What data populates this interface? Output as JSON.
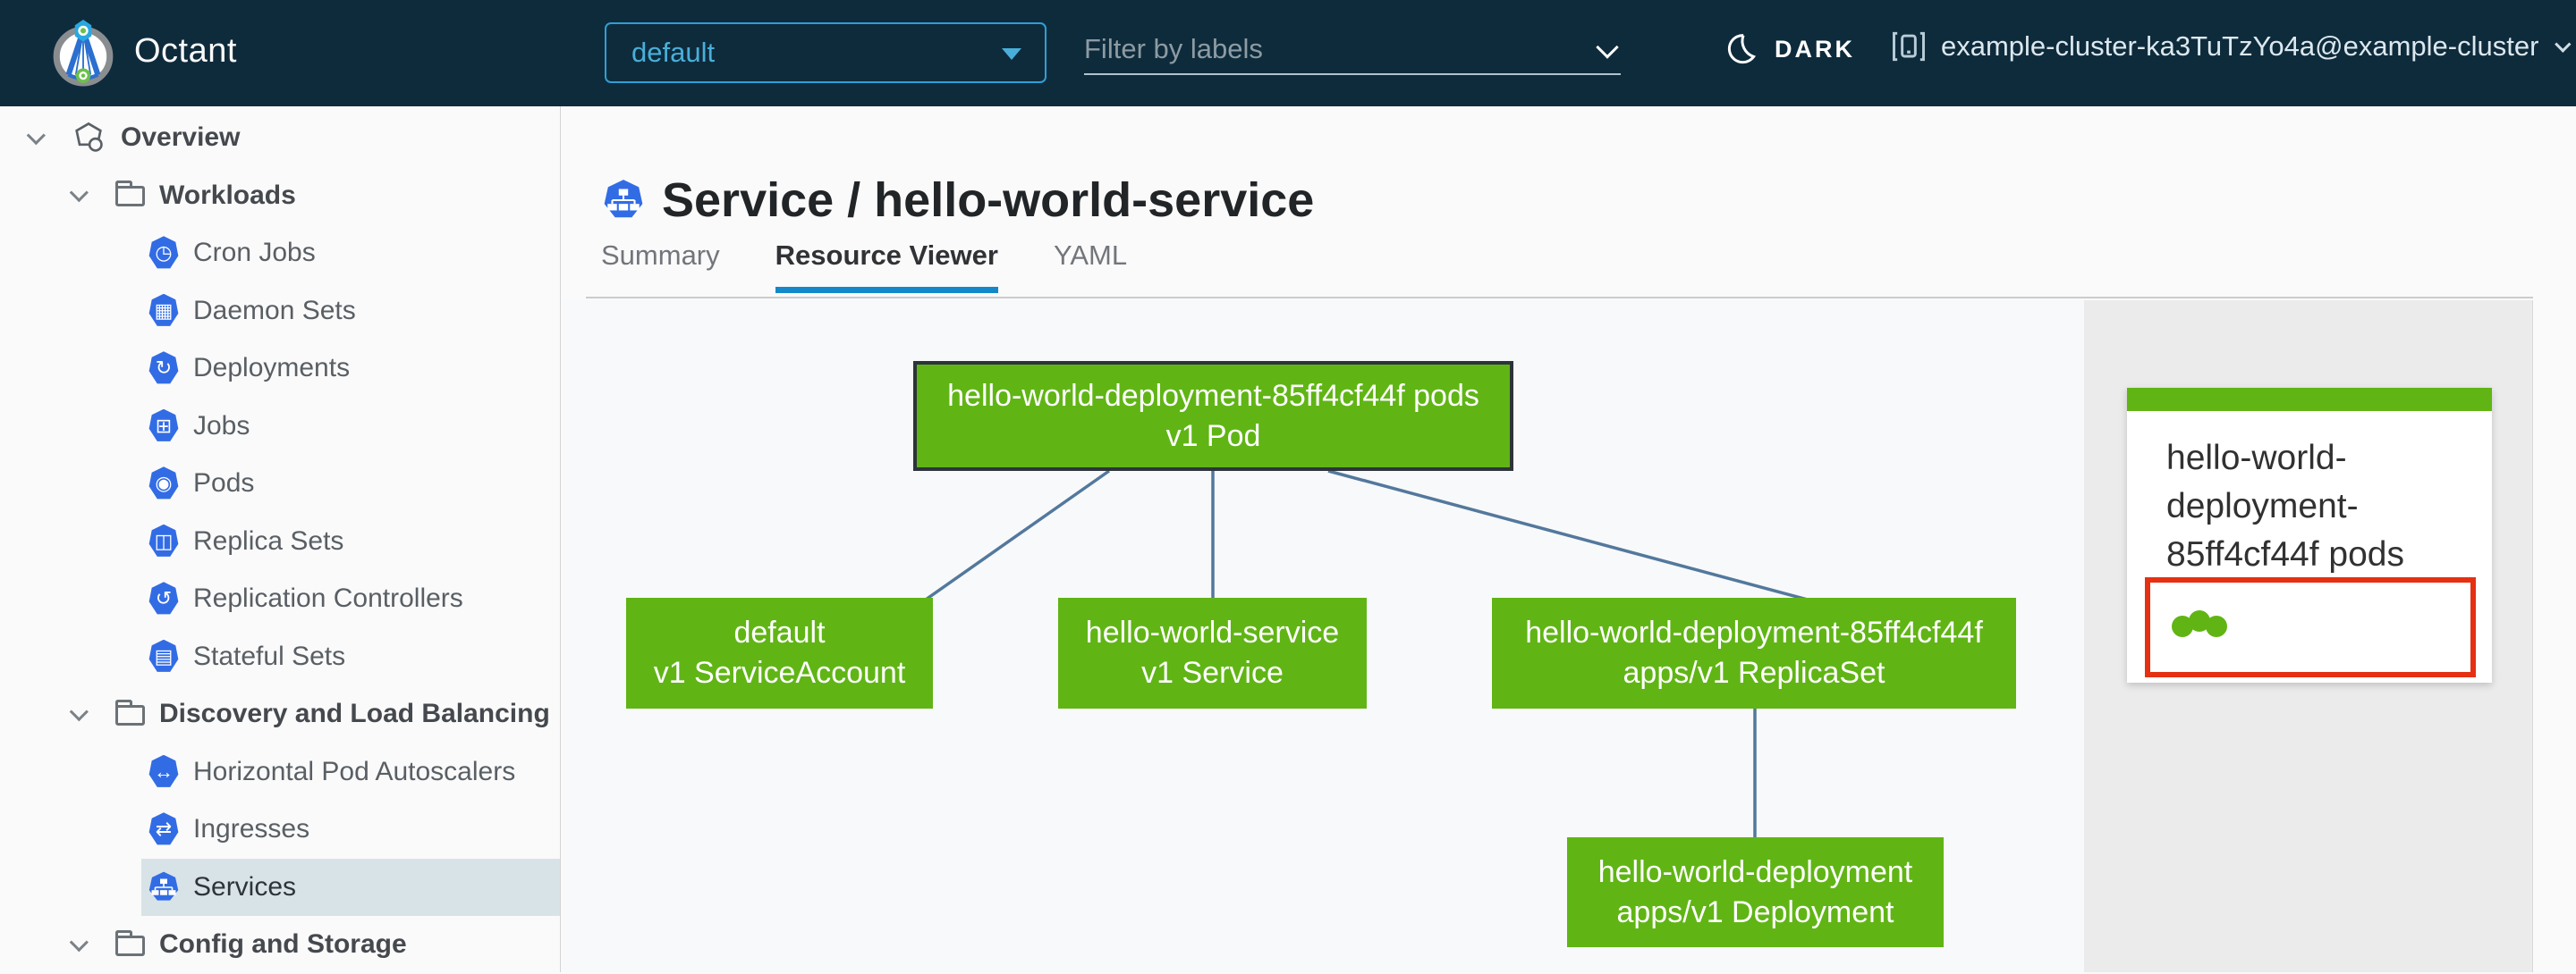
{
  "header": {
    "app_title": "Octant",
    "namespace_selector": {
      "value": "default"
    },
    "label_filter": {
      "placeholder": "Filter by labels"
    },
    "theme_toggle": {
      "label": "DARK"
    },
    "cluster": {
      "name": "example-cluster-ka3TuTzYo4a@example-cluster"
    }
  },
  "sidebar": {
    "items": [
      {
        "label": "Overview",
        "icon": "applications-icon",
        "glyph": ""
      },
      {
        "label": "Workloads",
        "icon": "folder-icon",
        "glyph": ""
      },
      {
        "label": "Cron Jobs",
        "icon": "k8s-cronjob-badge",
        "glyph": "◷"
      },
      {
        "label": "Daemon Sets",
        "icon": "k8s-daemonset-badge",
        "glyph": "▦"
      },
      {
        "label": "Deployments",
        "icon": "k8s-deployment-badge",
        "glyph": "↻"
      },
      {
        "label": "Jobs",
        "icon": "k8s-job-badge",
        "glyph": "⊞"
      },
      {
        "label": "Pods",
        "icon": "k8s-pod-badge",
        "glyph": "◉"
      },
      {
        "label": "Replica Sets",
        "icon": "k8s-replicaset-badge",
        "glyph": "◫"
      },
      {
        "label": "Replication Controllers",
        "icon": "k8s-replicationcontroller-badge",
        "glyph": "↺"
      },
      {
        "label": "Stateful Sets",
        "icon": "k8s-statefulset-badge",
        "glyph": "▤"
      },
      {
        "label": "Discovery and Load Balancing",
        "icon": "folder-icon",
        "glyph": ""
      },
      {
        "label": "Horizontal Pod Autoscalers",
        "icon": "k8s-hpa-badge",
        "glyph": "↔"
      },
      {
        "label": "Ingresses",
        "icon": "k8s-ingress-badge",
        "glyph": "⇄"
      },
      {
        "label": "Services",
        "icon": "k8s-service-badge",
        "glyph": ""
      },
      {
        "label": "Config and Storage",
        "icon": "folder-icon",
        "glyph": ""
      }
    ],
    "selected_item": "Services"
  },
  "main": {
    "page_title": "Service / hello-world-service",
    "title_icon": "k8s-service-badge",
    "tabs": [
      {
        "label": "Summary",
        "active": false
      },
      {
        "label": "Resource Viewer",
        "active": true
      },
      {
        "label": "YAML",
        "active": false
      }
    ]
  },
  "graph": {
    "nodes": [
      {
        "id": "pod",
        "line1": "hello-world-deployment-85ff4cf44f pods",
        "line2": "v1 Pod",
        "selected": true
      },
      {
        "id": "serviceaccount",
        "line1": "default",
        "line2": "v1 ServiceAccount",
        "selected": false
      },
      {
        "id": "service",
        "line1": "hello-world-service",
        "line2": "v1 Service",
        "selected": false
      },
      {
        "id": "replicaset",
        "line1": "hello-world-deployment-85ff4cf44f",
        "line2": "apps/v1 ReplicaSet",
        "selected": false
      },
      {
        "id": "deployment",
        "line1": "hello-world-deployment",
        "line2": "apps/v1 Deployment",
        "selected": false
      }
    ]
  },
  "detail_panel": {
    "card": {
      "title": "hello-world-deployment-85ff4cf44f pods",
      "pod_status_dots": 3
    }
  },
  "colors": {
    "header_bg": "#0e2b3c",
    "accent_blue": "#49afd9",
    "tab_underline_blue": "#1588c9",
    "k8s_badge_blue": "#326ce5",
    "node_green": "#60b515",
    "edge_blue": "#53789d",
    "alert_red": "#e53012",
    "selected_row_bg": "#d8e3e8",
    "panel_bg": "#ebebeb"
  }
}
